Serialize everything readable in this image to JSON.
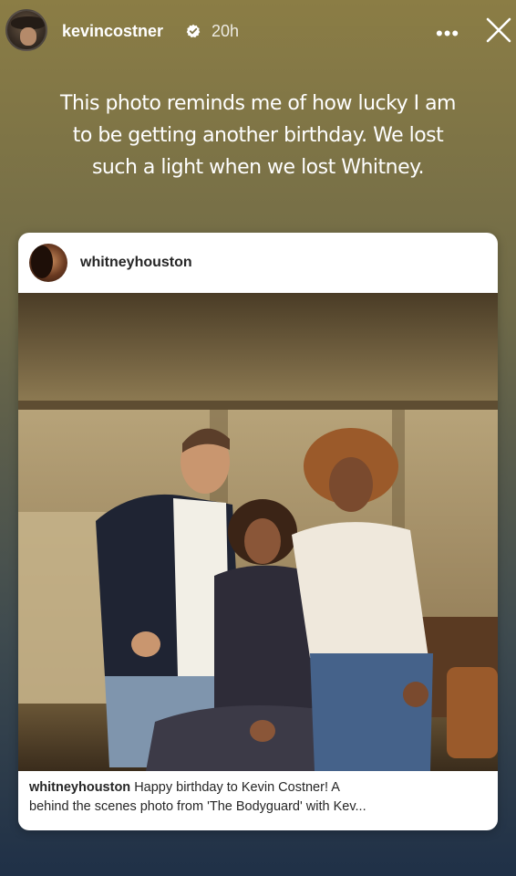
{
  "story": {
    "username": "kevincostner",
    "time": "20h",
    "more_glyph": "•••",
    "caption": "This photo reminds me of how lucky I am to be getting another birthday. We lost such a light when we lost Whitney."
  },
  "shared_post": {
    "username": "whitneyhouston",
    "caption_user": "whitneyhouston",
    "caption_line1": "Happy birthday to Kevin Costner! A",
    "caption_line2": "behind the scenes photo from 'The Bodyguard' with Kev..."
  },
  "icons": {
    "verified": "verified-badge-icon",
    "more": "more-options-icon",
    "close": "close-icon"
  },
  "colors": {
    "verified_badge": "#ffffff",
    "card_background": "#ffffff",
    "card_text": "#262626"
  }
}
